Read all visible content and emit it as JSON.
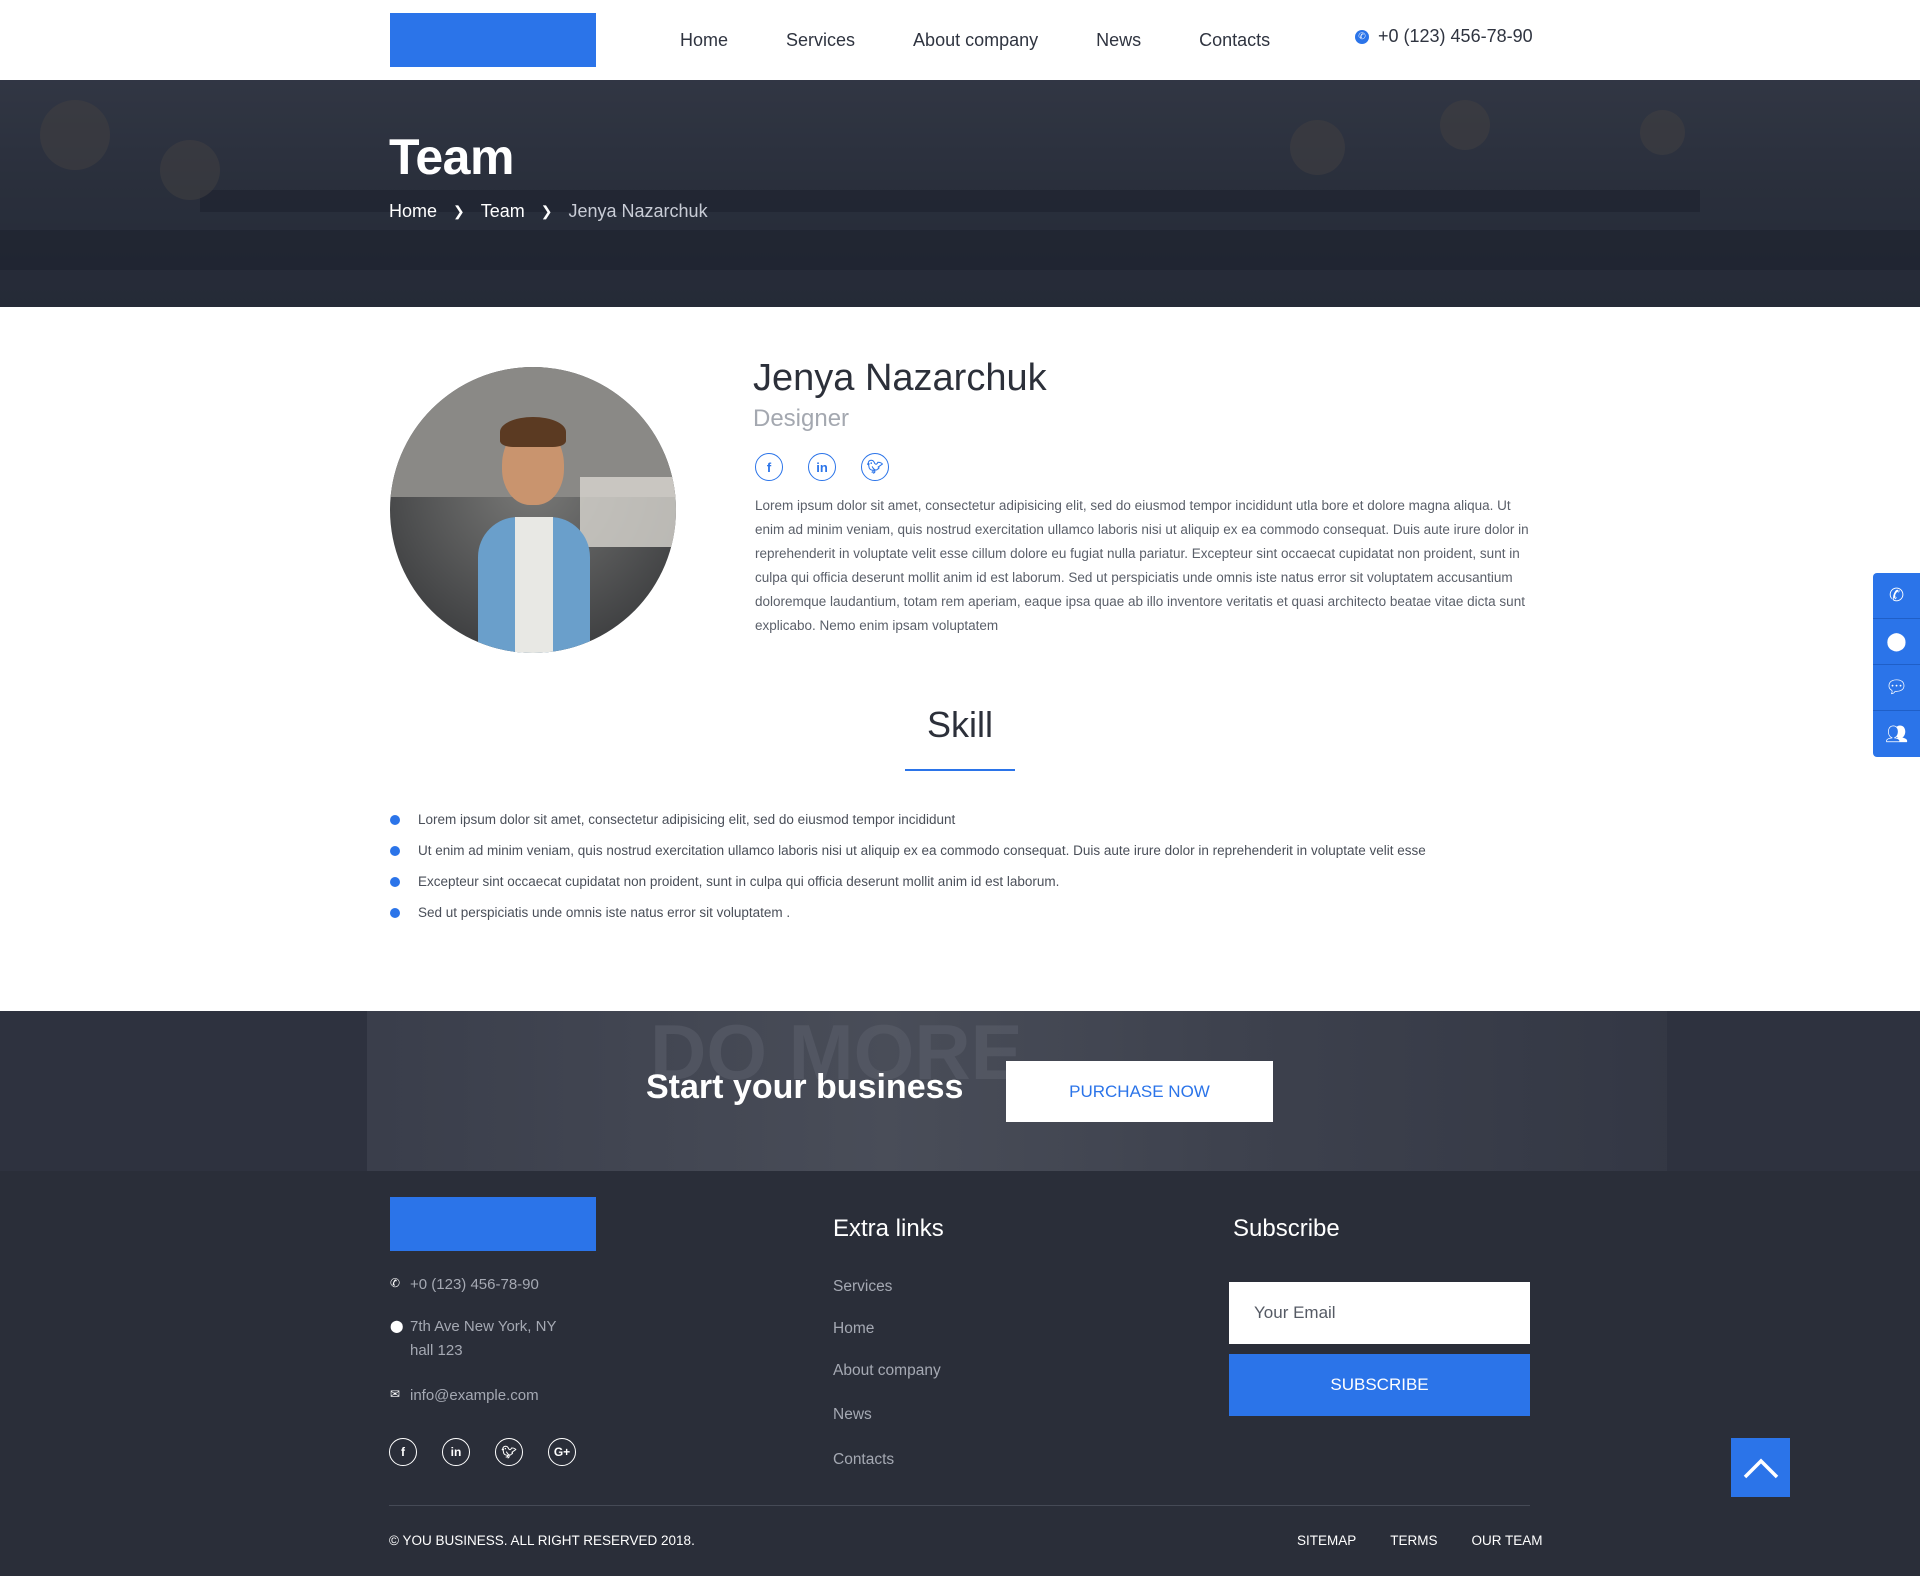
{
  "header": {
    "nav": [
      "Home",
      "Services",
      "About company",
      "News",
      "Contacts"
    ],
    "phone": "+0 (123) 456-78-90"
  },
  "hero": {
    "title": "Team",
    "breadcrumb": [
      "Home",
      "Team",
      "Jenya Nazarchuk"
    ]
  },
  "profile": {
    "name": "Jenya Nazarchuk",
    "role": "Designer",
    "socials": [
      "facebook-icon",
      "linkedin-icon",
      "twitter-icon"
    ],
    "bio": "Lorem ipsum dolor sit amet, consectetur adipisicing elit, sed do eiusmod tempor incididunt utla bore et dolore magna aliqua. Ut enim ad minim veniam, quis nostrud exercitation ullamco laboris nisi ut aliquip ex ea commodo consequat. Duis aute irure dolor in reprehenderit in voluptate velit esse cillum dolore eu fugiat nulla pariatur. Excepteur sint occaecat cupidatat non proident, sunt in culpa qui officia deserunt mollit anim id est laborum. Sed ut perspiciatis unde omnis iste natus error sit voluptatem accusantium doloremque laudantium, totam rem aperiam, eaque ipsa quae ab illo inventore veritatis et quasi architecto beatae vitae dicta sunt explicabo. Nemo enim ipsam voluptatem"
  },
  "skill": {
    "title": "Skill",
    "items": [
      "Lorem ipsum dolor sit amet, consectetur adipisicing elit, sed do eiusmod tempor incididunt",
      "Ut enim ad minim veniam, quis nostrud exercitation ullamco laboris nisi ut aliquip ex ea commodo consequat. Duis aute irure dolor in reprehenderit in voluptate velit esse",
      "Excepteur sint occaecat cupidatat non proident, sunt in culpa qui officia deserunt mollit anim id est laborum.",
      "Sed ut perspiciatis unde omnis iste natus error sit voluptatem ."
    ]
  },
  "side_panel": [
    "phone-icon",
    "map-pin-icon",
    "chat-icon",
    "team-icon"
  ],
  "cta": {
    "text": "Start your business",
    "button": "PURCHASE NOW",
    "background_text": "DO MORE."
  },
  "footer": {
    "phone": "+0 (123) 456-78-90",
    "address_line1": "7th Ave New York, NY",
    "address_line2": "hall 123",
    "email": "info@example.com",
    "socials": [
      "facebook-icon",
      "linkedin-icon",
      "twitter-icon",
      "google-plus-icon"
    ],
    "extra_links_title": "Extra links",
    "extra_links": [
      "Services",
      "Home",
      "About company",
      "News",
      "Contacts"
    ],
    "subscribe_title": "Subscribe",
    "email_placeholder": "Your Email",
    "subscribe_button": "SUBSCRIBE",
    "copyright": "© YOU BUSINESS. ALL RIGHT RESERVED 2018.",
    "bottom_links": [
      "SITEMAP",
      "TERMS",
      "OUR TEAM"
    ]
  },
  "colors": {
    "accent": "#2b74e9",
    "footer_bg": "#2a2e39",
    "text_dark": "#2c303a"
  }
}
